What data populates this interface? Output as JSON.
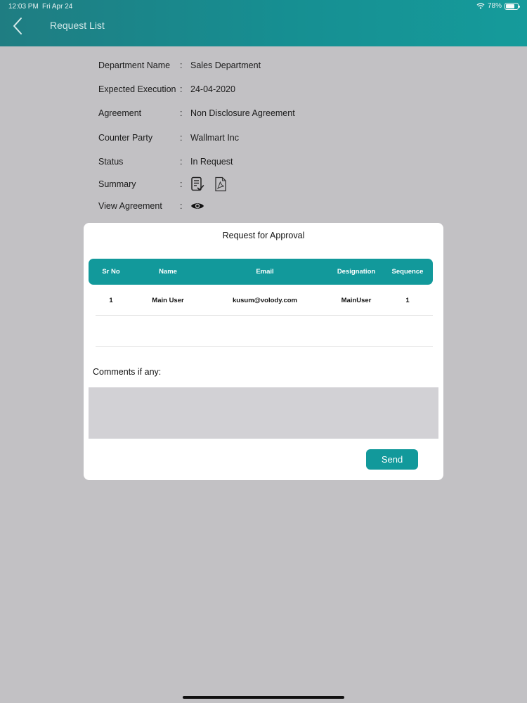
{
  "status_bar": {
    "time": "12:03 PM",
    "date": "Fri Apr 24",
    "battery": "78%",
    "battery_level": 0.78
  },
  "nav": {
    "title": "Request List",
    "back_icon": "chevron-left-icon"
  },
  "details": [
    {
      "label": "Department Name",
      "value": "Sales Department"
    },
    {
      "label": "Expected Execution",
      "value": "24-04-2020"
    },
    {
      "label": "Agreement",
      "value": "Non Disclosure Agreement"
    },
    {
      "label": "Counter Party",
      "value": "Wallmart Inc"
    },
    {
      "label": "Status",
      "value": "In Request"
    },
    {
      "label": "Summary",
      "icons": [
        "document-check-icon",
        "pdf-icon"
      ]
    },
    {
      "label": "View Agreement",
      "icons": [
        "eye-icon"
      ]
    }
  ],
  "detail_colon": ":",
  "modal": {
    "title": "Request for Approval",
    "columns": [
      "Sr No",
      "Name",
      "Email",
      "Designation",
      "Sequence"
    ],
    "rows": [
      {
        "sr_no": "1",
        "name": "Main User",
        "email": "kusum@volody.com",
        "designation": "MainUser",
        "sequence": "1"
      }
    ],
    "comments_label": "Comments if any:",
    "comments_value": "",
    "send_label": "Send"
  },
  "colors": {
    "accent": "#12999b",
    "header_start": "#1f7d82",
    "overlay": "#c2c1c4"
  }
}
